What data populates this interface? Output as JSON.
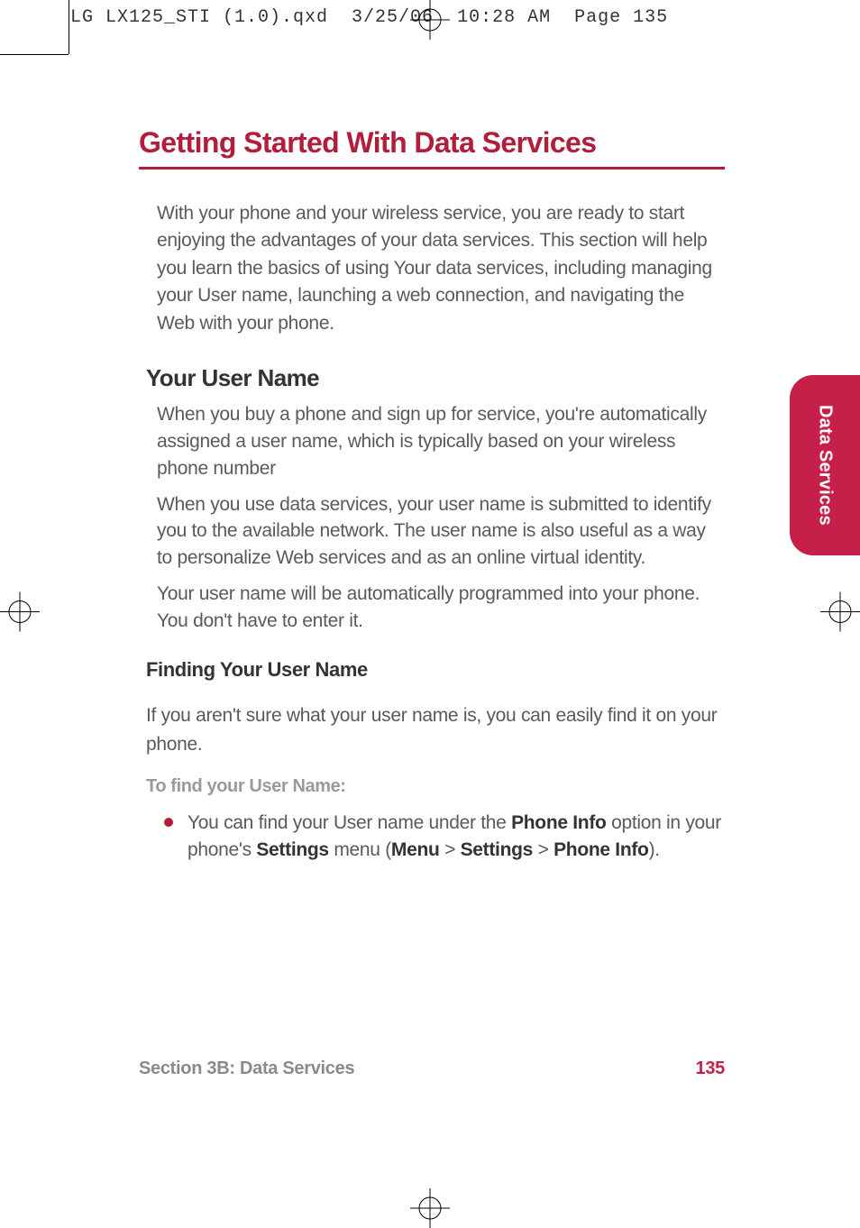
{
  "slug": "LG LX125_STI (1.0).qxd  3/25/06  10:28 AM  Page 135",
  "title": "Getting Started With Data Services",
  "intro": "With your phone and your wireless service, you are ready to start enjoying the advantages of your data services. This section will help you learn the basics of using Your data services, including managing your User name, launching a web connection, and navigating the Web with your phone.",
  "section1": {
    "heading": "Your User Name",
    "p1": "When you buy a phone and sign up for service, you're automatically assigned a user name, which is typically based on your wireless phone number",
    "p2": "When you use data services, your user name is submitted to identify you to the available network. The user name is also useful as a way to personalize Web services and as an online virtual identity.",
    "p3": "Your user name will be automatically programmed into your phone. You don't have to enter it."
  },
  "section2": {
    "heading": "Finding Your User Name",
    "lead": "If you aren't sure what your user name is, you can easily find it on your phone.",
    "step_label": "To find your User Name:",
    "bullet_pre": "You can find your User name under the ",
    "bullet_b1": "Phone Info",
    "bullet_mid1": " option in your phone's ",
    "bullet_b2": "Settings",
    "bullet_mid2": " menu (",
    "bullet_b3": "Menu",
    "bullet_gt1": " > ",
    "bullet_b4": "Settings",
    "bullet_gt2": " > ",
    "bullet_b5": "Phone Info",
    "bullet_end": ")."
  },
  "side_tab": "Data Services",
  "footer": {
    "section": "Section 3B: Data Services",
    "page": "135"
  }
}
